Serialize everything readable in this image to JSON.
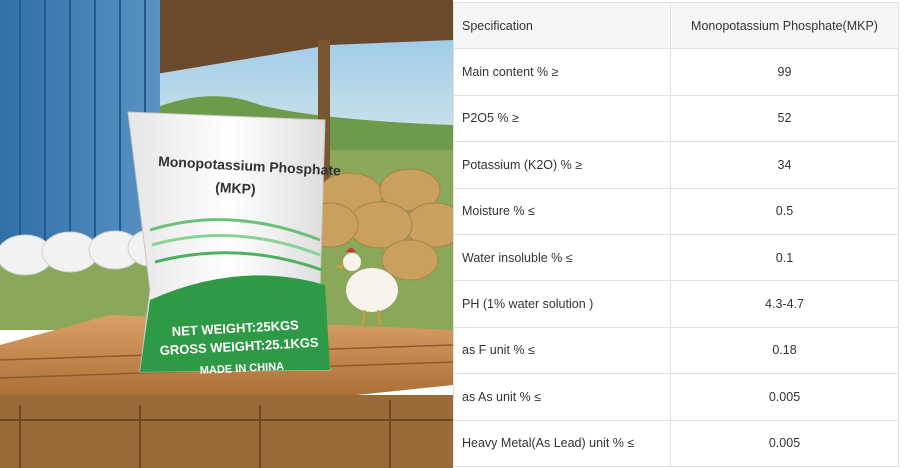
{
  "photo": {
    "bag_title_line1": "Monopotassium Phosphate",
    "bag_title_line2": "(MKP)",
    "net_weight": "NET WEIGHT:25KGS",
    "gross_weight": "GROSS WEIGHT:25.1KGS",
    "made_in": "MADE IN CHINA"
  },
  "table": {
    "header": {
      "name": "Specification",
      "value": "Monopotassium Phosphate(MKP)"
    },
    "rows": [
      {
        "name": "Main content % ≥",
        "value": "99"
      },
      {
        "name": "P2O5 % ≥",
        "value": "52"
      },
      {
        "name": "Potassium (K2O) % ≥",
        "value": "34"
      },
      {
        "name": "Moisture % ≤",
        "value": "0.5"
      },
      {
        "name": "Water insoluble % ≤",
        "value": "0.1"
      },
      {
        "name": "PH (1% water solution )",
        "value": "4.3-4.7"
      },
      {
        "name": "as F unit % ≤",
        "value": "0.18"
      },
      {
        "name": "as As unit % ≤",
        "value": "0.005"
      },
      {
        "name": "Heavy Metal(As Lead) unit % ≤",
        "value": "0.005"
      }
    ]
  }
}
